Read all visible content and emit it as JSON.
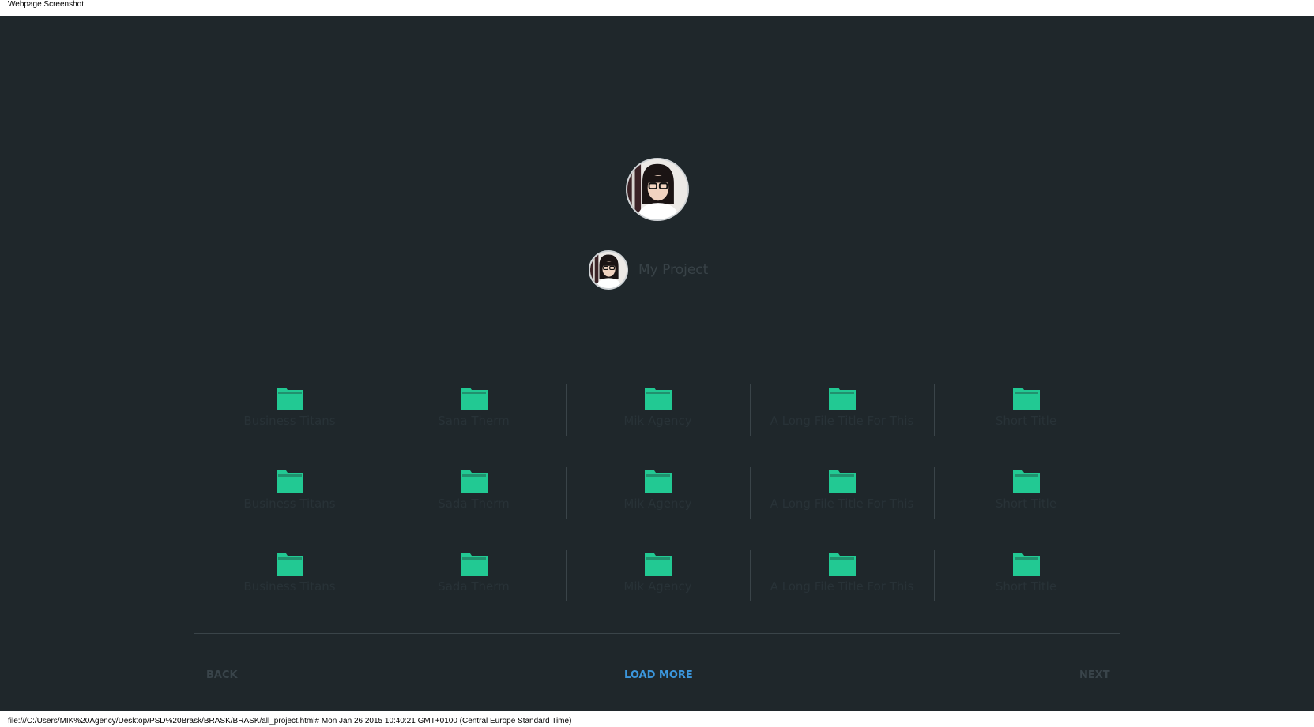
{
  "print_header": {
    "title": "Webpage Screenshot"
  },
  "print_footer": {
    "text": "file:///C:/Users/MIK%20Agency/Desktop/PSD%20Brask/BRASK/BRASK/all_project.html# Mon Jan 26 2015 10:40:21 GMT+0100 (Central Europe Standard Time)"
  },
  "project": {
    "title": "My Project"
  },
  "folders": [
    [
      "Business Titans",
      "Sana Therm",
      "Mik Agency",
      "A Long File Title For This",
      "Short Title"
    ],
    [
      "Business Titans",
      "Sada Therm",
      "Mik Agency",
      "A Long File Title For This",
      "Short Title"
    ],
    [
      "Business Titans",
      "Sada Therm",
      "Mik Agency",
      "A Long File Title For This",
      "Short Title"
    ]
  ],
  "pagination": {
    "back": "BACK",
    "load_more": "LOAD MORE",
    "next": "NEXT"
  },
  "colors": {
    "background": "#1f272b",
    "folder": "#22c993",
    "load_more": "#3b96dc",
    "muted_text": "#39444a"
  },
  "icons": {
    "folder": "folder-icon"
  }
}
